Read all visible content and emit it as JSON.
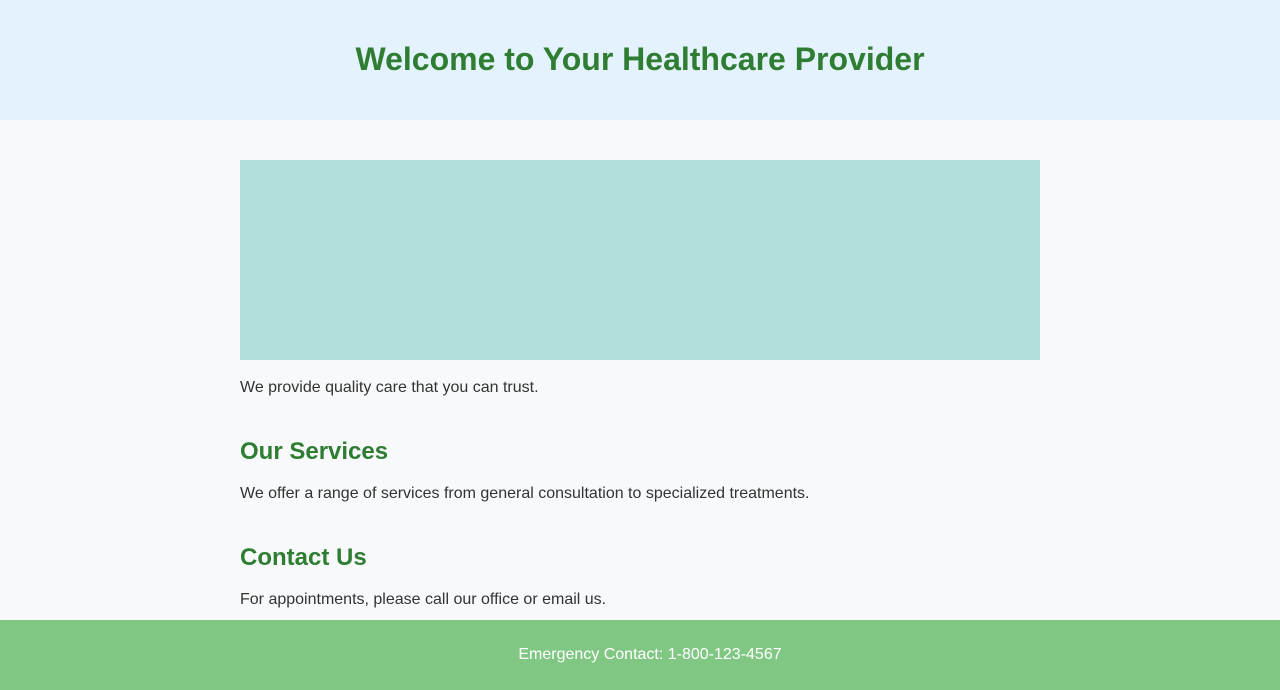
{
  "header": {
    "title": "Welcome to Your Healthcare Provider"
  },
  "main": {
    "intro": "We provide quality care that you can trust.",
    "sections": [
      {
        "title": "Our Services",
        "text": "We offer a range of services from general consultation to specialized treatments."
      },
      {
        "title": "Contact Us",
        "text": "For appointments, please call our office or email us."
      }
    ]
  },
  "footer": {
    "text": "Emergency Contact: 1-800-123-4567"
  },
  "colors": {
    "header_bg": "#e3f2fd",
    "heading": "#2e7d32",
    "hero_bg": "#b2dfdb",
    "footer_bg": "#81c784",
    "body_bg": "#f7f9fb"
  }
}
